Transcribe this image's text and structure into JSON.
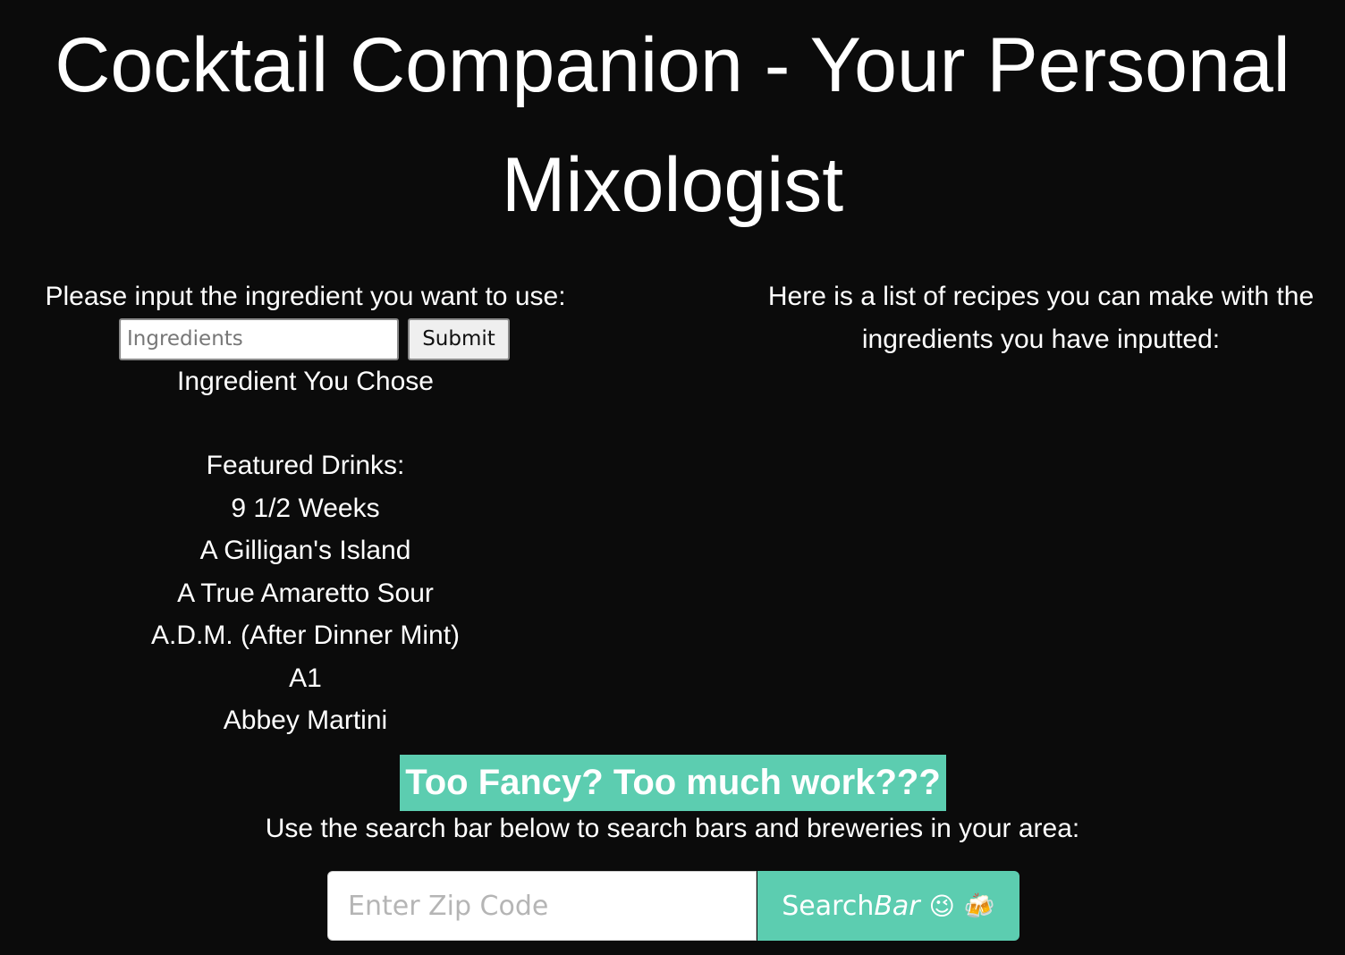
{
  "header": {
    "title": "Cocktail Companion - Your Personal Mixologist"
  },
  "ingredient_form": {
    "prompt": "Please input the ingredient you want to use:",
    "input_placeholder": "Ingredients",
    "input_value": "",
    "submit_label": "Submit",
    "chosen_label": "Ingredient You Chose"
  },
  "featured": {
    "heading": "Featured Drinks:",
    "drinks": [
      "9 1/2 Weeks",
      "A Gilligan's Island",
      "A True Amaretto Sour",
      "A.D.M. (After Dinner Mint)",
      "A1",
      "Abbey Martini"
    ]
  },
  "recipes": {
    "heading": "Here is a list of recipes you can make with the ingredients you have inputted:"
  },
  "bar_search": {
    "banner": "Too Fancy? Too much work???",
    "help_text": "Use the search bar below to search bars and breweries in your area:",
    "zip_placeholder": "Enter Zip Code",
    "zip_value": "",
    "button_label_plain": "Search",
    "button_label_italic": "Bar",
    "button_emojis": [
      "😉",
      "🍻"
    ],
    "accent_color": "#5ccdb0"
  }
}
